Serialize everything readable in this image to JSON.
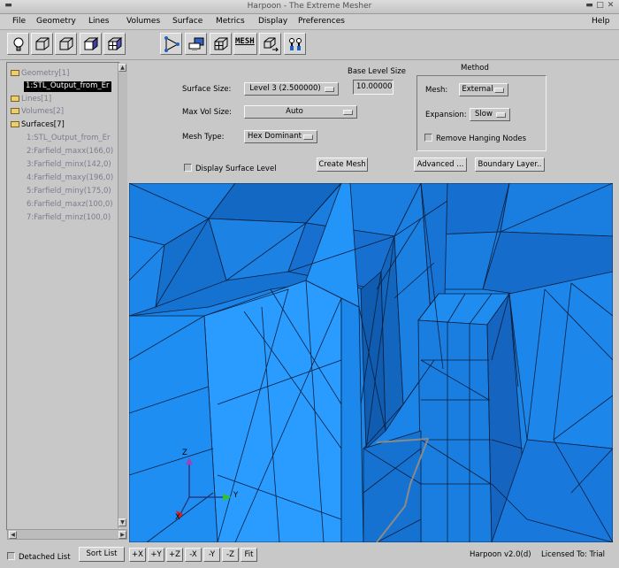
{
  "window": {
    "title": "Harpoon - The Extreme Mesher"
  },
  "menubar": {
    "items": [
      "File",
      "Geometry",
      "Lines",
      "Volumes",
      "Surface",
      "Metrics",
      "Display",
      "Preferences"
    ],
    "help": "Help"
  },
  "toolbar": {
    "icons": [
      "bulb-icon",
      "cube-icon",
      "cube-outline-icon",
      "cube-shaded-icon",
      "cube-grid-icon",
      "triangle-nodes-icon",
      "monitor-icon",
      "cube-mesh-icon",
      "mesh-text-icon",
      "cube-export-icon",
      "tools-icon"
    ],
    "mesh_label": "MESH"
  },
  "tree": {
    "items": [
      {
        "label": "Geometry[1]",
        "folder": true,
        "dim": true
      },
      {
        "label": "1:STL_Output_from_Er",
        "selected": true
      },
      {
        "label": "Lines[1]",
        "folder": true,
        "dim": true
      },
      {
        "label": "Volumes[2]",
        "folder": true,
        "dim": true
      },
      {
        "label": "Surfaces[7]",
        "folder": true,
        "dim": false
      },
      {
        "label": "1:STL_Output_from_Er",
        "dim": true
      },
      {
        "label": "2:Farfield_maxx(166,0)",
        "dim": true
      },
      {
        "label": "3:Farfield_minx(142,0)",
        "dim": true
      },
      {
        "label": "4:Farfield_maxy(196,0)",
        "dim": true
      },
      {
        "label": "5:Farfield_miny(175,0)",
        "dim": true
      },
      {
        "label": "6:Farfield_maxz(100,0)",
        "dim": true
      },
      {
        "label": "7:Farfield_minz(100,0)",
        "dim": true
      }
    ]
  },
  "controls": {
    "base_level_label": "Base Level Size",
    "base_level_value": "10.00000",
    "surface_size_label": "Surface  Size:",
    "surface_size_value": "Level 3 (2.500000)",
    "max_vol_label": "Max Vol  Size:",
    "max_vol_value": "Auto",
    "mesh_type_label": "Mesh Type:",
    "mesh_type_value": "Hex Dominant",
    "display_surface_level": "Display Surface Level",
    "create_mesh": "Create Mesh",
    "advanced": "Advanced ...",
    "boundary_layer": "Boundary Layer.."
  },
  "method": {
    "title": "Method",
    "mesh_label": "Mesh:",
    "mesh_value": "External",
    "expansion_label": "Expansion:",
    "expansion_value": "Slow",
    "remove_hanging_nodes": "Remove Hanging Nodes"
  },
  "axes": {
    "z": "Z",
    "y": "Y",
    "x": "X"
  },
  "statusbar": {
    "detached_list": "Detached List",
    "sort_list": "Sort List",
    "view_buttons": [
      "+X",
      "+Y",
      "+Z",
      "-X",
      "-Y",
      "-Z",
      "Fit"
    ],
    "version": "Harpoon v2.0(d)",
    "license": "Licensed To: Trial"
  },
  "colors": {
    "viewport_base": "#1a84e8",
    "mesh_line": "#0a1e3c",
    "accent_selected": "#000000"
  }
}
